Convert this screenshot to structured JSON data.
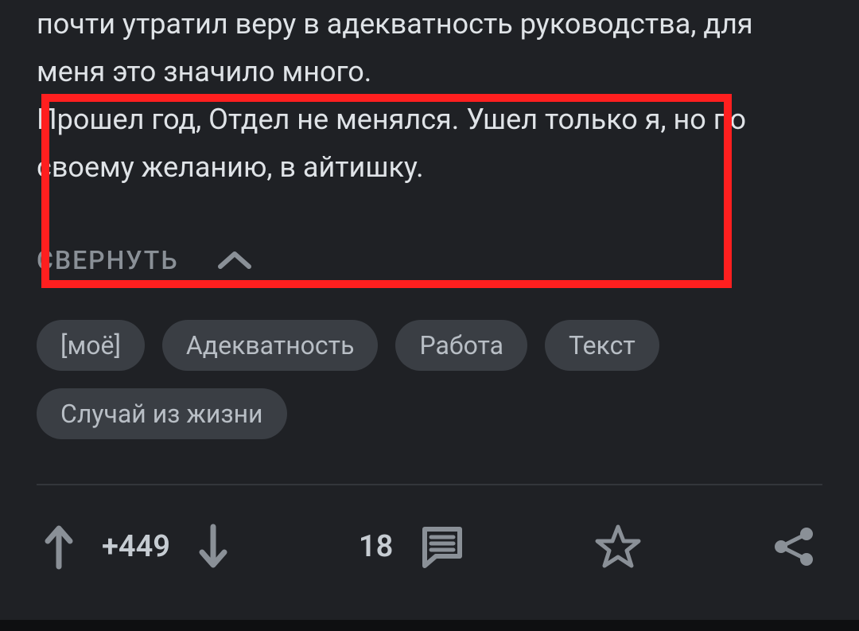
{
  "post": {
    "paragraph1": "почти утратил веру в адекватность руководства, для меня это значило много.",
    "paragraph2": "Прошел год, Отдел не менялся. Ушел только я, но по своему желанию, в айтишку.",
    "collapse_label": "СВЕРНУТЬ"
  },
  "tags": [
    "[моё]",
    "Адекватность",
    "Работа",
    "Текст",
    "Случай из жизни"
  ],
  "actions": {
    "score": "+449",
    "comments": "18"
  },
  "colors": {
    "bg": "#1f2125",
    "tag_bg": "#3a3e44",
    "icon": "#8a9097",
    "highlight": "#ff1f1f"
  }
}
